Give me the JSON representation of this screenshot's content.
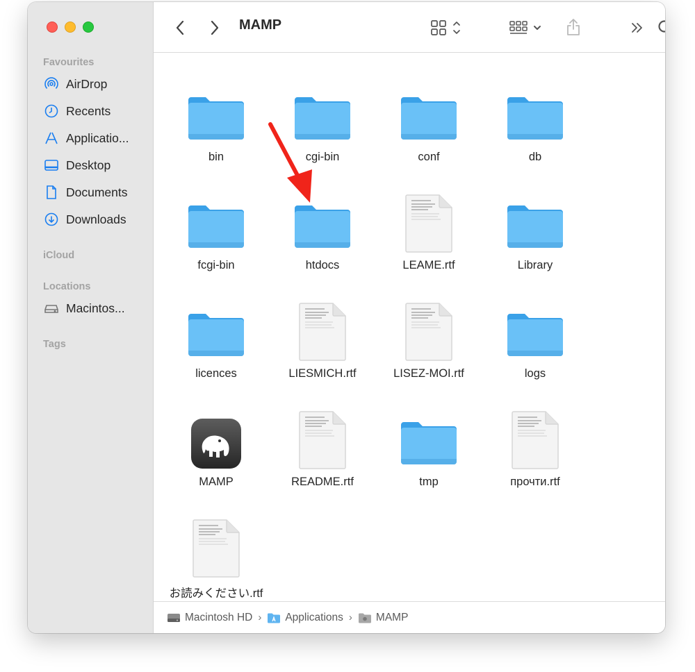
{
  "window": {
    "title": "MAMP"
  },
  "toolbar": {
    "back_icon": "chevron-left-icon",
    "forward_icon": "chevron-right-icon",
    "view_icon": "grid-view-icon",
    "group_icon": "group-by-icon",
    "share_icon": "share-icon",
    "more_icon": "double-chevron-icon",
    "search_icon": "search-icon"
  },
  "sidebar": {
    "favourites_label": "Favourites",
    "items": [
      {
        "label": "AirDrop",
        "icon": "airdrop-icon"
      },
      {
        "label": "Recents",
        "icon": "clock-icon"
      },
      {
        "label": "Applicatio...",
        "icon": "applications-icon"
      },
      {
        "label": "Desktop",
        "icon": "desktop-icon"
      },
      {
        "label": "Documents",
        "icon": "document-icon"
      },
      {
        "label": "Downloads",
        "icon": "download-icon"
      }
    ],
    "icloud_label": "iCloud",
    "locations_label": "Locations",
    "locations": [
      {
        "label": "Macintos...",
        "icon": "drive-icon"
      }
    ],
    "tags_label": "Tags"
  },
  "files": [
    {
      "name": "bin",
      "type": "folder"
    },
    {
      "name": "cgi-bin",
      "type": "folder"
    },
    {
      "name": "conf",
      "type": "folder"
    },
    {
      "name": "db",
      "type": "folder"
    },
    {
      "name": "fcgi-bin",
      "type": "folder"
    },
    {
      "name": "htdocs",
      "type": "folder"
    },
    {
      "name": "LEAME.rtf",
      "type": "document"
    },
    {
      "name": "Library",
      "type": "folder"
    },
    {
      "name": "licences",
      "type": "folder"
    },
    {
      "name": "LIESMICH.rtf",
      "type": "document"
    },
    {
      "name": "LISEZ-MOI.rtf",
      "type": "document"
    },
    {
      "name": "logs",
      "type": "folder"
    },
    {
      "name": "MAMP",
      "type": "app"
    },
    {
      "name": "README.rtf",
      "type": "document"
    },
    {
      "name": "tmp",
      "type": "folder"
    },
    {
      "name": "прочти.rtf",
      "type": "document"
    },
    {
      "name": "お読みください.rtf",
      "type": "document"
    }
  ],
  "pathbar": [
    {
      "label": "Macintosh HD",
      "icon": "drive-icon"
    },
    {
      "label": "Applications",
      "icon": "applications-folder-icon"
    },
    {
      "label": "MAMP",
      "icon": "folder-gray-icon"
    }
  ],
  "pathbar_separator": "›",
  "colors": {
    "folder": "#69c0f6",
    "folder_tab": "#4aa8e8",
    "arrow": "#f0241a",
    "accent": "#1a7ef0"
  }
}
